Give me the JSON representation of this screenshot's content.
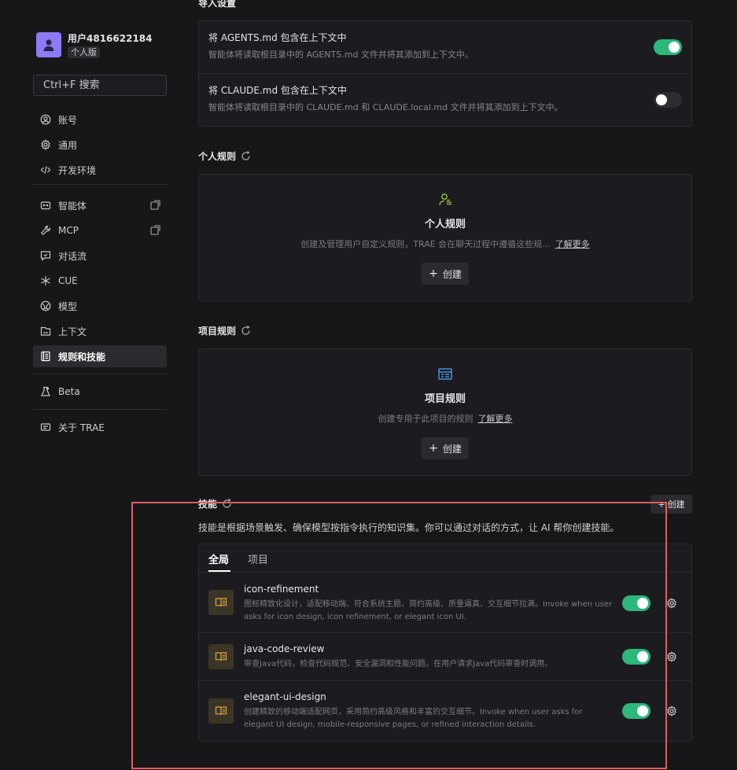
{
  "sidebar": {
    "user": {
      "name": "用户4816622184",
      "plan": "个人版"
    },
    "search_placeholder": "Ctrl+F 搜索",
    "items": [
      {
        "label": "账号",
        "icon": "user-circle-icon"
      },
      {
        "label": "通用",
        "icon": "gear-icon"
      },
      {
        "label": "开发环境",
        "icon": "code-icon"
      },
      {
        "label": "智能体",
        "icon": "bot-icon"
      },
      {
        "label": "MCP",
        "icon": "wrench-icon"
      },
      {
        "label": "对话流",
        "icon": "chat-flow-icon"
      },
      {
        "label": "CUE",
        "icon": "sparkle-icon"
      },
      {
        "label": "模型",
        "icon": "model-icon"
      },
      {
        "label": "上下文",
        "icon": "context-icon"
      },
      {
        "label": "规则和技能",
        "icon": "rules-icon",
        "active": true
      },
      {
        "label": "Beta",
        "icon": "beta-icon"
      },
      {
        "label": "关于 TRAE",
        "icon": "about-icon"
      }
    ]
  },
  "import": {
    "title": "导入设置",
    "agents": {
      "title": "将 AGENTS.md 包含在上下文中",
      "desc": "智能体将读取根目录中的 AGENTS.md 文件并将其添加到上下文中。",
      "enabled": true
    },
    "claude": {
      "title": "将 CLAUDE.md 包含在上下文中",
      "desc": "智能体将读取根目录中的 CLAUDE.md 和 CLAUDE.local.md 文件并将其添加到上下文中。",
      "enabled": false
    }
  },
  "personal_rules": {
    "title": "个人规则",
    "card_title": "个人规则",
    "desc": "创建及管理用户自定义规则，TRAE 会在聊天过程中遵循这些规...",
    "learn_more": "了解更多",
    "create": "创建"
  },
  "project_rules": {
    "title": "项目规则",
    "card_title": "项目规则",
    "desc": "创建专用于此项目的规则",
    "learn_more": "了解更多",
    "create": "创建"
  },
  "skills": {
    "title": "技能",
    "create": "创建",
    "desc": "技能是根据场景触发、确保模型按指令执行的知识集。你可以通过对话的方式，让 AI 帮你创建技能。",
    "tabs": [
      "全局",
      "项目"
    ],
    "items": [
      {
        "name": "icon-refinement",
        "desc": "图标精致化设计，适配移动端、符合系统主题、简约高级、质量逼真、交互细节拉满。Invoke when user asks for icon design, icon refinement, or elegant icon UI.",
        "enabled": true
      },
      {
        "name": "java-code-review",
        "desc": "审查Java代码，检查代码规范、安全漏洞和性能问题。在用户请求Java代码审查时调用。",
        "enabled": true
      },
      {
        "name": "elegant-ui-design",
        "desc": "创建精致的移动端适配网页，采用简约高级风格和丰富的交互细节。Invoke when user asks for elegant UI design, mobile-responsive pages, or refined interaction details.",
        "enabled": true
      }
    ]
  },
  "colors": {
    "accent_green": "#2db77a",
    "highlight_red": "#e35d5d",
    "avatar_purple": "#8b7cf6"
  }
}
